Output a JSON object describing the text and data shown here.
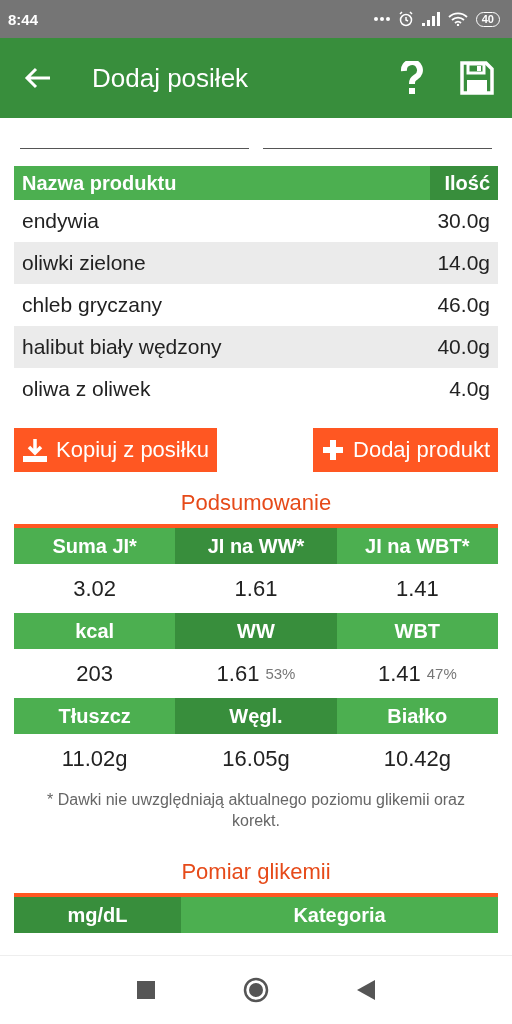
{
  "status_bar": {
    "time": "8:44",
    "battery": "40"
  },
  "app_bar": {
    "title": "Dodaj posiłek"
  },
  "products": {
    "columns": [
      "Nazwa produktu",
      "Ilość"
    ],
    "rows": [
      {
        "name": "endywia",
        "amount": "30.0g"
      },
      {
        "name": "oliwki zielone",
        "amount": "14.0g"
      },
      {
        "name": "chleb gryczany",
        "amount": "46.0g"
      },
      {
        "name": "halibut biały wędzony",
        "amount": "40.0g"
      },
      {
        "name": "oliwa z oliwek",
        "amount": "4.0g"
      }
    ]
  },
  "buttons": [
    {
      "kind": "copy",
      "label": "Kopiuj z posiłku"
    },
    {
      "kind": "add",
      "label": "Dodaj produkt"
    }
  ],
  "summary": {
    "title": "Podsumowanie",
    "groups": [
      {
        "headers": [
          "Suma JI*",
          "JI na WW*",
          "JI na WBT*"
        ],
        "values": [
          {
            "value": "3.02"
          },
          {
            "value": "1.61"
          },
          {
            "value": "1.41"
          }
        ]
      },
      {
        "headers": [
          "kcal",
          "WW",
          "WBT"
        ],
        "values": [
          {
            "value": "203"
          },
          {
            "value": "1.61",
            "share": "53%"
          },
          {
            "value": "1.41",
            "share": "47%"
          }
        ]
      },
      {
        "headers": [
          "Tłuszcz",
          "Węgl.",
          "Białko"
        ],
        "values": [
          {
            "value": "11.02g"
          },
          {
            "value": "16.05g"
          },
          {
            "value": "10.42g"
          }
        ]
      }
    ],
    "note": "* Dawki nie uwzględniają aktualnego poziomu glikemii oraz korekt."
  },
  "glycemia": {
    "title": "Pomiar glikemii",
    "columns": [
      "mg/dL",
      "Kategoria"
    ]
  }
}
